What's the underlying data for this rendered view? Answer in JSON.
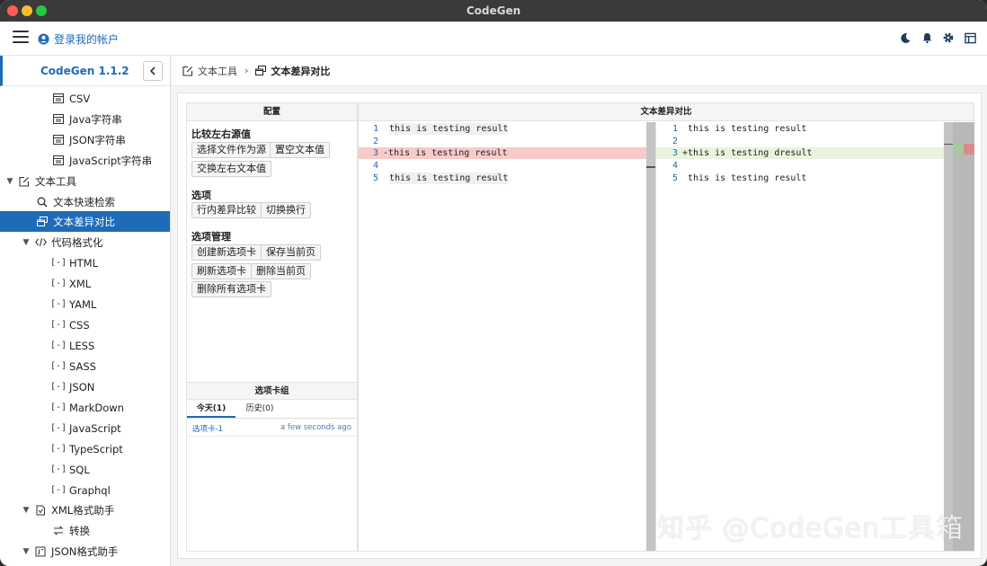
{
  "window": {
    "title": "CodeGen"
  },
  "header": {
    "login_label": "登录我的帐户"
  },
  "sidebar": {
    "app_title": "CodeGen 1.1.2",
    "items": [
      {
        "label": "CSV",
        "icon": "table-icon"
      },
      {
        "label": "Java字符串",
        "icon": "table-icon"
      },
      {
        "label": "JSON字符串",
        "icon": "table-icon"
      },
      {
        "label": "JavaScript字符串",
        "icon": "table-icon"
      },
      {
        "label": "文本工具",
        "icon": "edit-box-icon"
      },
      {
        "label": "文本快速检索",
        "icon": "search-icon"
      },
      {
        "label": "文本差异对比",
        "icon": "windows-icon"
      },
      {
        "label": "代码格式化",
        "icon": "code-icon"
      },
      {
        "label": "HTML",
        "icon": "bracket-icon"
      },
      {
        "label": "XML",
        "icon": "bracket-icon"
      },
      {
        "label": "YAML",
        "icon": "bracket-icon"
      },
      {
        "label": "CSS",
        "icon": "bracket-icon"
      },
      {
        "label": "LESS",
        "icon": "bracket-icon"
      },
      {
        "label": "SASS",
        "icon": "bracket-icon"
      },
      {
        "label": "JSON",
        "icon": "bracket-icon"
      },
      {
        "label": "MarkDown",
        "icon": "bracket-icon"
      },
      {
        "label": "JavaScript",
        "icon": "bracket-icon"
      },
      {
        "label": "TypeScript",
        "icon": "bracket-icon"
      },
      {
        "label": "SQL",
        "icon": "bracket-icon"
      },
      {
        "label": "Graphql",
        "icon": "bracket-icon"
      },
      {
        "label": "XML格式助手",
        "icon": "xml-helper-icon"
      },
      {
        "label": "转换",
        "icon": "convert-icon"
      },
      {
        "label": "JSON格式助手",
        "icon": "json-helper-icon"
      }
    ]
  },
  "breadcrumb": {
    "parent": "文本工具",
    "current": "文本差异对比"
  },
  "config": {
    "title": "配置",
    "section_source": "比较左右源值",
    "btn_select_file": "选择文件作为源",
    "btn_clear_text": "置空文本值",
    "btn_swap": "交换左右文本值",
    "section_options": "选项",
    "btn_inline_diff": "行内差异比较",
    "btn_toggle_wrap": "切换换行",
    "section_tab_mgmt": "选项管理",
    "btn_new_tab": "创建新选项卡",
    "btn_save_page": "保存当前页",
    "btn_refresh_tab": "刷新选项卡",
    "btn_delete_page": "删除当前页",
    "btn_delete_all": "删除所有选项卡"
  },
  "tab_group": {
    "title": "选项卡组",
    "tab_today": "今天(1)",
    "tab_history": "历史(0)",
    "entries": [
      {
        "name": "选项卡-1",
        "time": "a few seconds ago"
      }
    ]
  },
  "diff": {
    "title": "文本差异对比",
    "left_lines": [
      {
        "num": "1",
        "text": "this is testing result"
      },
      {
        "num": "2",
        "text": ""
      },
      {
        "num": "3",
        "text": "-this is testing result"
      },
      {
        "num": "4",
        "text": ""
      },
      {
        "num": "5",
        "text": "this is testing result"
      }
    ],
    "right_lines": [
      {
        "num": "1",
        "text": "this is testing result"
      },
      {
        "num": "2",
        "text": ""
      },
      {
        "num": "3",
        "text": "+this is testing dresult"
      },
      {
        "num": "4",
        "text": ""
      },
      {
        "num": "5",
        "text": "this is testing result"
      }
    ],
    "colors": {
      "removed": "#f8caca",
      "added": "#e9f3dd",
      "scrollbar": "#c4c4c4"
    }
  },
  "watermark": "知乎 @CodeGen工具箱"
}
